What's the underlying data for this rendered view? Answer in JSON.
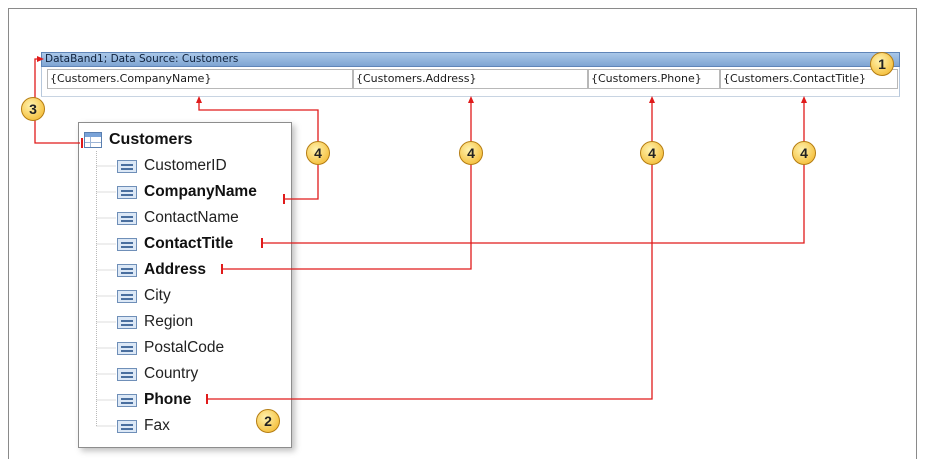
{
  "band": {
    "header_text": "DataBand1; Data Source: Customers",
    "fields": [
      "{Customers.CompanyName}",
      "{Customers.Address}",
      "{Customers.Phone}",
      "{Customers.ContactTitle}"
    ]
  },
  "dictionary": {
    "table_name": "Customers",
    "columns": [
      {
        "name": "CustomerID",
        "used": false
      },
      {
        "name": "CompanyName",
        "used": true
      },
      {
        "name": "ContactName",
        "used": false
      },
      {
        "name": "ContactTitle",
        "used": true
      },
      {
        "name": "Address",
        "used": true
      },
      {
        "name": "City",
        "used": false
      },
      {
        "name": "Region",
        "used": false
      },
      {
        "name": "PostalCode",
        "used": false
      },
      {
        "name": "Country",
        "used": false
      },
      {
        "name": "Phone",
        "used": true
      },
      {
        "name": "Fax",
        "used": false
      }
    ]
  },
  "callouts": {
    "band": "1",
    "dictionary": "2",
    "data_source_link": "3",
    "field_link": "4"
  },
  "colors": {
    "connector": "#e01b1b",
    "band_header": "#8fb1dc",
    "callout_fill": "#f6c549"
  }
}
